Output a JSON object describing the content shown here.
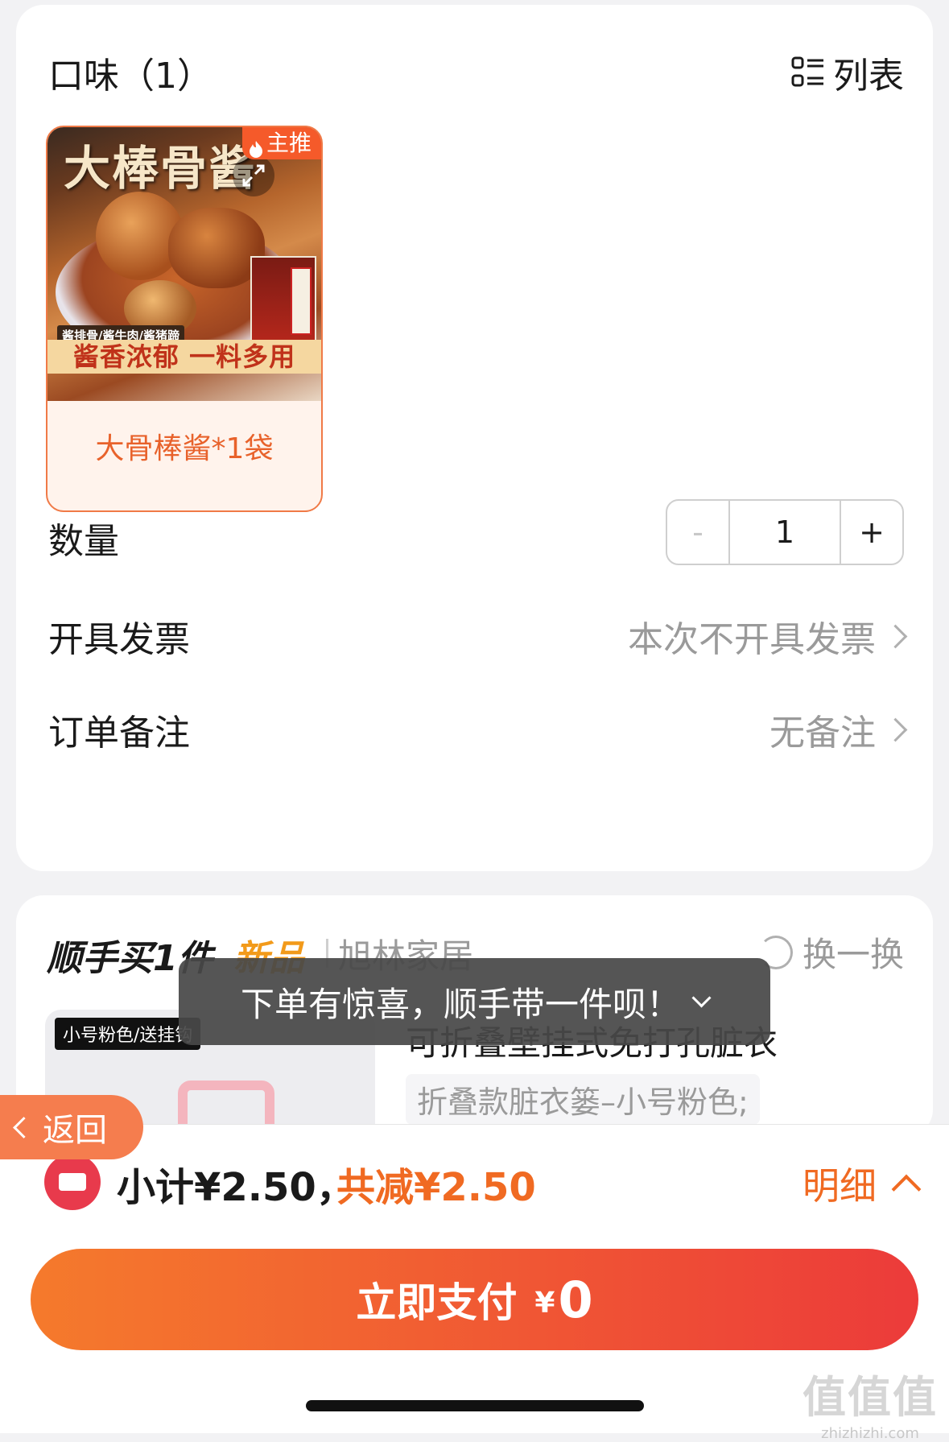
{
  "flavor": {
    "title": "口味（1）",
    "list_toggle": "列表"
  },
  "product": {
    "badge": "主推",
    "name": "大骨棒酱*1袋",
    "image_brand": "大棒骨酱",
    "image_sub": "酱排骨/酱牛肉/酱猪蹄",
    "image_slogan": "酱香浓郁 一料多用"
  },
  "quantity": {
    "label": "数量",
    "minus": "-",
    "value": "1",
    "plus": "+"
  },
  "invoice": {
    "label": "开具发票",
    "value": "本次不开具发票"
  },
  "note": {
    "label": "订单备注",
    "value": "无备注"
  },
  "recommend": {
    "title": "顺手买1件",
    "new_tag": "新品",
    "shop": "旭林家居",
    "swap": "换一换",
    "thumb_tag": "小号粉色/送挂钩",
    "product_name": "可折叠壁挂式免打孔脏衣",
    "spec": "折叠款脏衣篓–小号粉色;"
  },
  "toast": {
    "text": "下单有惊喜，顺手带一件呗！"
  },
  "back": {
    "label": "返回"
  },
  "summary": {
    "subtotal": "小计¥2.50，",
    "discount": "共减¥2.50",
    "detail": "明细"
  },
  "pay": {
    "label": "立即支付",
    "currency": "¥",
    "amount": "0"
  },
  "watermark": {
    "main": "值值值",
    "sub": "zhizhizhi.com"
  },
  "colors": {
    "accent": "#f06a22",
    "pay_start": "#f57a2c",
    "pay_end": "#ec3b3a",
    "badge": "#f55a2a"
  },
  "icons": [
    "list-icon",
    "flame-icon",
    "expand-icon",
    "chevron-right-icon",
    "swap-icon",
    "chevron-down-icon",
    "chevron-left-icon",
    "coupon-icon",
    "chevron-up-icon"
  ]
}
